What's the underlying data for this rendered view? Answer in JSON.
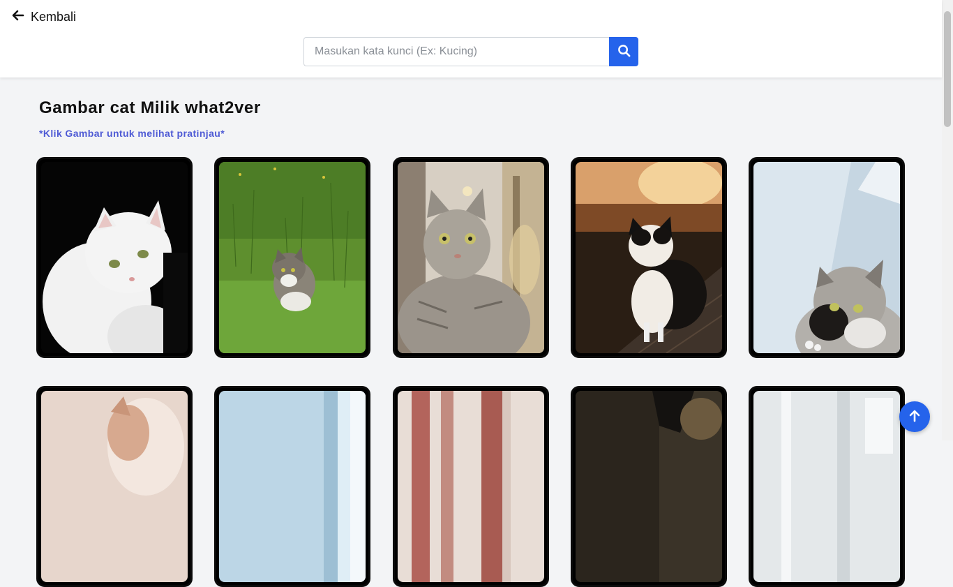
{
  "nav": {
    "back_label": "Kembali"
  },
  "search": {
    "placeholder": "Masukan kata kunci (Ex: Kucing)",
    "value": ""
  },
  "gallery": {
    "title": "Gambar cat Milik what2ver",
    "hint": "*Klik Gambar untuk melihat pratinjau*"
  },
  "colors": {
    "accent": "#2563eb",
    "hint": "#4f5bd5",
    "card_border": "#0b0b0b"
  },
  "icons": {
    "back": "arrow-left-icon",
    "search": "search-icon",
    "to_top": "arrow-up-icon"
  }
}
